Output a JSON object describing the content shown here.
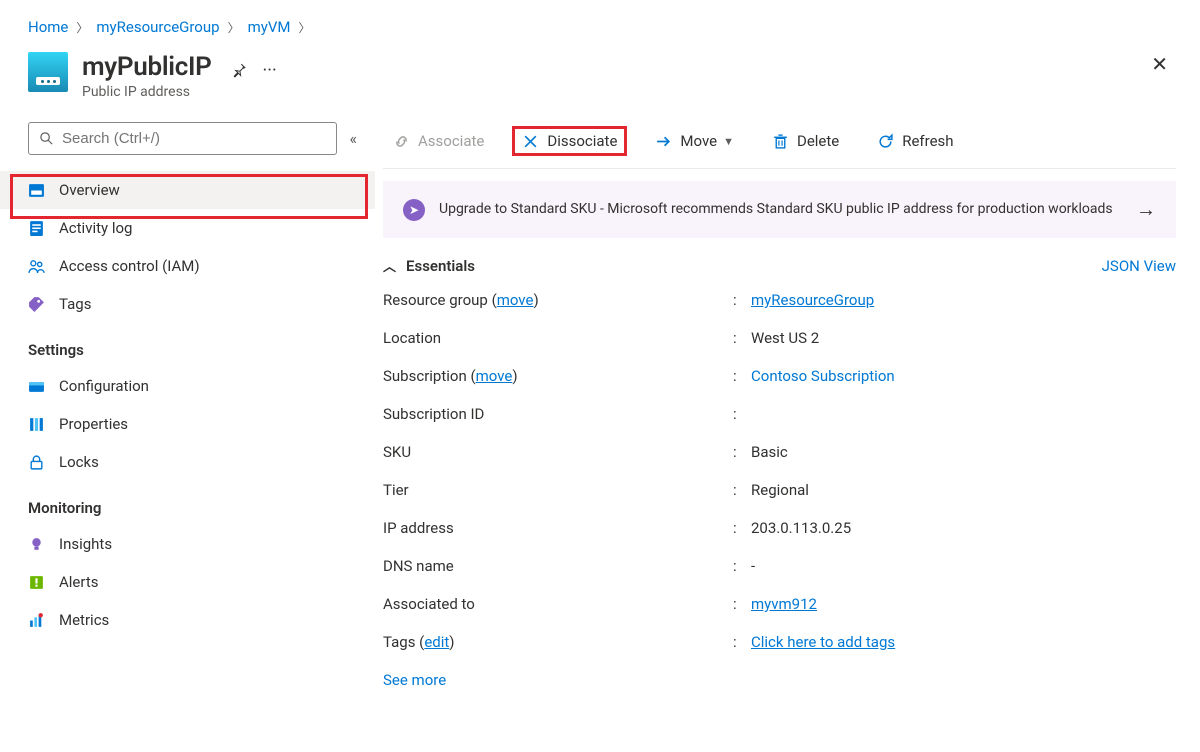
{
  "breadcrumb": [
    {
      "label": "Home"
    },
    {
      "label": "myResourceGroup"
    },
    {
      "label": "myVM"
    }
  ],
  "header": {
    "title": "myPublicIP",
    "subtitle": "Public IP address"
  },
  "sidebar": {
    "search_placeholder": "Search (Ctrl+/)",
    "items_top": [
      {
        "label": "Overview",
        "icon": "resource-icon",
        "selected": true
      },
      {
        "label": "Activity log",
        "icon": "log-icon"
      },
      {
        "label": "Access control (IAM)",
        "icon": "people-icon"
      },
      {
        "label": "Tags",
        "icon": "tag-icon"
      }
    ],
    "section_settings": "Settings",
    "items_settings": [
      {
        "label": "Configuration",
        "icon": "config-icon"
      },
      {
        "label": "Properties",
        "icon": "props-icon"
      },
      {
        "label": "Locks",
        "icon": "lock-icon"
      }
    ],
    "section_monitoring": "Monitoring",
    "items_monitoring": [
      {
        "label": "Insights",
        "icon": "bulb-icon"
      },
      {
        "label": "Alerts",
        "icon": "alert-icon"
      },
      {
        "label": "Metrics",
        "icon": "metrics-icon"
      }
    ]
  },
  "toolbar": {
    "associate": "Associate",
    "dissociate": "Dissociate",
    "move": "Move",
    "delete": "Delete",
    "refresh": "Refresh"
  },
  "banner": {
    "text": "Upgrade to Standard SKU - Microsoft recommends Standard SKU public IP address for production workloads"
  },
  "essentials": {
    "heading": "Essentials",
    "json_view": "JSON View",
    "move_link": "move",
    "edit_link": "edit",
    "rows": {
      "resource_group_label": "Resource group",
      "resource_group_value": "myResourceGroup",
      "location_label": "Location",
      "location_value": "West US 2",
      "subscription_label": "Subscription",
      "subscription_value": "Contoso Subscription",
      "subscription_id_label": "Subscription ID",
      "subscription_id_value": "",
      "sku_label": "SKU",
      "sku_value": "Basic",
      "tier_label": "Tier",
      "tier_value": "Regional",
      "ip_label": "IP address",
      "ip_value": "203.0.113.0.25",
      "dns_label": "DNS name",
      "dns_value": "-",
      "assoc_label": "Associated to",
      "assoc_value": "myvm912",
      "tags_label": "Tags",
      "tags_value": "Click here to add tags"
    },
    "see_more": "See more"
  }
}
